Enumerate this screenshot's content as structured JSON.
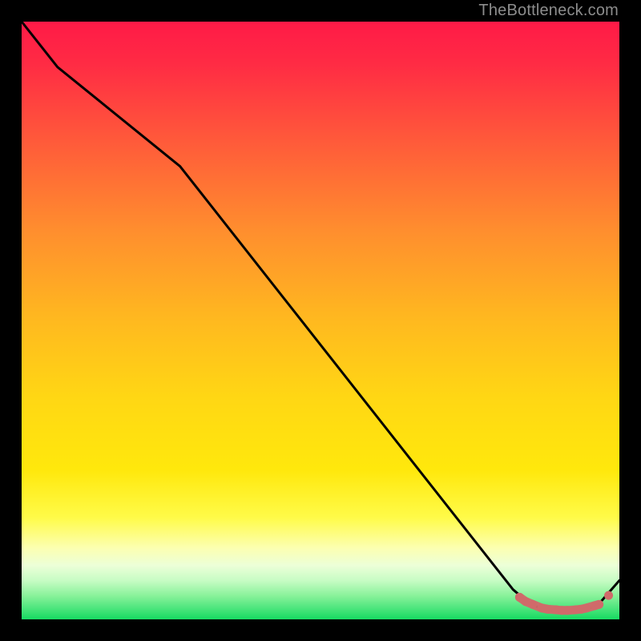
{
  "watermark": "TheBottleneck.com",
  "chart_data": {
    "type": "line",
    "title": "",
    "xlabel": "",
    "ylabel": "",
    "xlim": [
      0,
      100
    ],
    "ylim": [
      0,
      100
    ],
    "gradient": {
      "top_color": "#ff1a47",
      "mid_color": "#ffe400",
      "bottom_color": "#17da62",
      "description": "Vertical red→yellow→green background representing bottleneck severity"
    },
    "series": [
      {
        "name": "bottleneck-curve",
        "color": "#000000",
        "x": [
          0.0,
          6.0,
          26.5,
          82.2,
          85.0,
          87.0,
          89.0,
          91.0,
          93.0,
          95.0,
          96.5,
          100.0
        ],
        "y": [
          100.0,
          92.4,
          75.8,
          5.0,
          2.6,
          1.8,
          1.5,
          1.4,
          1.5,
          1.9,
          2.5,
          6.5
        ]
      },
      {
        "name": "highlight-dots",
        "color": "#d06a6a",
        "x": [
          83.3,
          84.3,
          85.5,
          87.0,
          88.0,
          89.4,
          90.4,
          91.3,
          92.7,
          93.6,
          94.5,
          95.9,
          96.6
        ],
        "y": [
          3.7,
          3.0,
          2.5,
          1.9,
          1.7,
          1.6,
          1.5,
          1.5,
          1.6,
          1.7,
          1.9,
          2.3,
          2.5
        ]
      }
    ]
  }
}
